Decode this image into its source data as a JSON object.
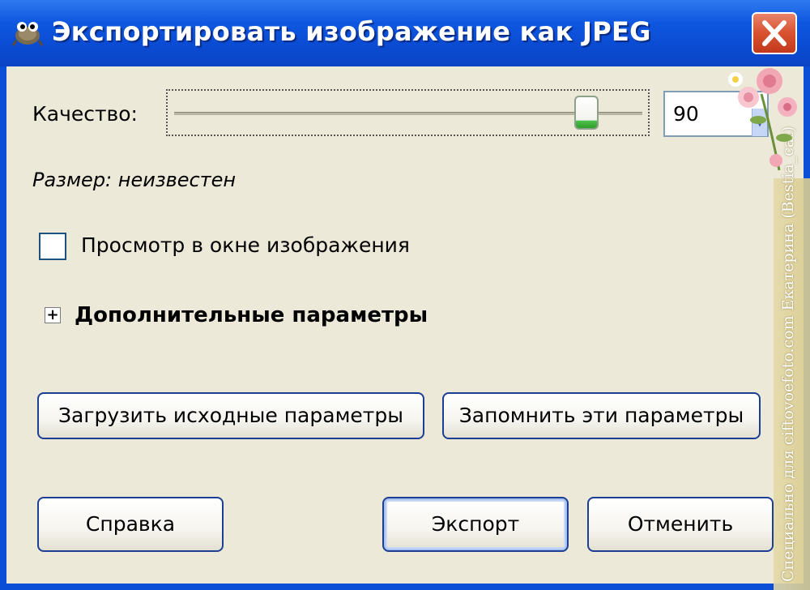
{
  "window": {
    "title": "Экспортировать изображение как JPEG",
    "title_color": "#0a4fd6"
  },
  "quality": {
    "label": "Качество:",
    "value": "90",
    "level": 0.9
  },
  "size": {
    "label": "Размер: неизвестен"
  },
  "preview": {
    "label": "Просмотр в окне изображения",
    "checked": false
  },
  "advanced": {
    "label": "Дополнительные параметры",
    "expander_glyph": "+"
  },
  "buttons": {
    "load_defaults": "Загрузить исходные параметры",
    "save_defaults": "Запомнить эти параметры",
    "help": "Справка",
    "export": "Экспорт",
    "cancel": "Отменить"
  },
  "watermark": {
    "text": "Специально для ciftovoefoto.com Екатерина (Bestia_cat)"
  },
  "colors": {
    "titlebar": "#0a4fd6",
    "client_bg": "#ece9d8",
    "close_button": "#d8512f",
    "button_border": "#1c3f94"
  }
}
